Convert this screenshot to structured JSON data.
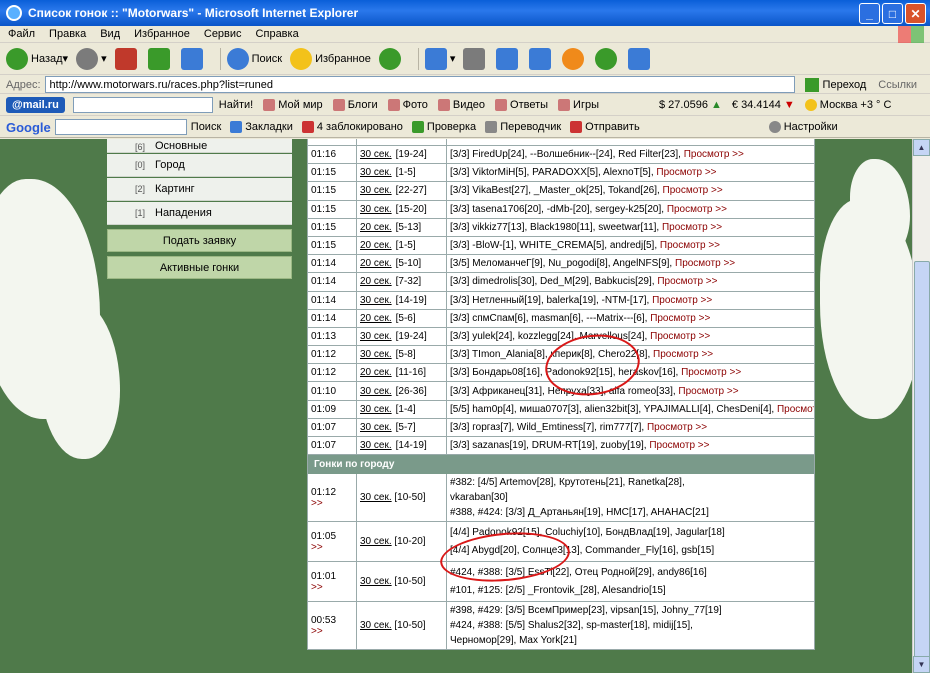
{
  "window": {
    "title": "Список гонок :: \"Motorwars\" - Microsoft Internet Explorer"
  },
  "menu": [
    "Файл",
    "Правка",
    "Вид",
    "Избранное",
    "Сервис",
    "Справка"
  ],
  "toolbar": {
    "back": "Назад",
    "search": "Поиск",
    "favorites": "Избранное"
  },
  "address": {
    "label": "Адрес:",
    "url": "http://www.motorwars.ru/races.php?list=runed",
    "go": "Переход",
    "links": "Ссылки"
  },
  "mailbar": {
    "logo": "@mail.ru",
    "find": "Найти!",
    "myworld": "Мой мир",
    "blogs": "Блоги",
    "photo": "Фото",
    "video": "Видео",
    "answers": "Ответы",
    "games": "Игры",
    "usd": "$ 27.0596",
    "eur": "€ 34.4144",
    "weather": "Москва +3 ° C"
  },
  "googlebar": {
    "logo": "Google",
    "search": "Поиск",
    "bookmarks": "Закладки",
    "blocked": "4 заблокировано",
    "check": "Проверка",
    "translate": "Переводчик",
    "send": "Отправить",
    "settings": "Настройки"
  },
  "sidebar": {
    "items": [
      {
        "count": "[6]",
        "label": "Основные"
      },
      {
        "count": "[0]",
        "label": "Город"
      },
      {
        "count": "[2]",
        "label": "Картинг"
      },
      {
        "count": "[1]",
        "label": "Нападения"
      }
    ],
    "btn_apply": "Подать заявку",
    "btn_active": "Активные гонки"
  },
  "races": [
    {
      "time": "01:16",
      "dur": "30 сек.",
      "lvl": "[19-24]",
      "players": "[3/3] FiredUp[24], --Волшебник--[24], Red Filter[23],",
      "view": "Просмотр >>"
    },
    {
      "time": "01:15",
      "dur": "30 сек.",
      "lvl": "[1-5]",
      "players": "[3/3] ViktorMiH[5], PARADOXX[5], AlexnoT[5],",
      "view": "Просмотр >>"
    },
    {
      "time": "01:15",
      "dur": "30 сек.",
      "lvl": "[22-27]",
      "players": "[3/3] VikaBest[27], _Master_ok[25], Tokand[26],",
      "view": "Просмотр >>"
    },
    {
      "time": "01:15",
      "dur": "30 сек.",
      "lvl": "[15-20]",
      "players": "[3/3] tasena1706[20], -dMb-[20], sergey-k25[20],",
      "view": "Просмотр >>"
    },
    {
      "time": "01:15",
      "dur": "20 сек.",
      "lvl": "[5-13]",
      "players": "[3/3] vikkiz77[13], Black1980[11], sweetwar[11],",
      "view": "Просмотр >>"
    },
    {
      "time": "01:15",
      "dur": "20 сек.",
      "lvl": "[1-5]",
      "players": "[3/3] -BloW-[1], WHITE_CREMA[5], andredj[5],",
      "view": "Просмотр >>"
    },
    {
      "time": "01:14",
      "dur": "20 сек.",
      "lvl": "[5-10]",
      "players": "[3/5] МеломанчеГ[9], Nu_pogodi[8], AngelNFS[9],",
      "view": "Просмотр >>"
    },
    {
      "time": "01:14",
      "dur": "20 сек.",
      "lvl": "[7-32]",
      "players": "[3/3] dimedrolis[30], Ded_M[29], Babkucis[29],",
      "view": "Просмотр >>"
    },
    {
      "time": "01:14",
      "dur": "30 сек.",
      "lvl": "[14-19]",
      "players": "[3/3] Нетленный[19], balerka[19], -NTM-[17],",
      "view": "Просмотр >>"
    },
    {
      "time": "01:14",
      "dur": "20 сек.",
      "lvl": "[5-6]",
      "players": "[3/3] спмСпам[6], masman[6], ---Matrix---[6],",
      "view": "Просмотр >>"
    },
    {
      "time": "01:13",
      "dur": "30 сек.",
      "lvl": "[19-24]",
      "players": "[3/3] yulek[24], kozzlegg[24], Marvellous[24],",
      "view": "Просмотр >>"
    },
    {
      "time": "01:12",
      "dur": "30 сек.",
      "lvl": "[5-8]",
      "players": "[3/3] TImon_Alania[8], кперик[8], Chero22[8],",
      "view": "Просмотр >>"
    },
    {
      "time": "01:12",
      "dur": "20 сек.",
      "lvl": "[11-16]",
      "players": "[3/3] Бондарь08[16], Padonok92[15], heraskov[16],",
      "view": "Просмотр >>"
    },
    {
      "time": "01:10",
      "dur": "30 сек.",
      "lvl": "[26-36]",
      "players": "[3/3] Африканец[31], Непруха[33], alfa romeo[33],",
      "view": "Просмотр >>"
    },
    {
      "time": "01:09",
      "dur": "30 сек.",
      "lvl": "[1-4]",
      "players": "[5/5] ham0p[4], миша0707[3], alien32bit[3], YPAJIMALLI[4], ChesDeni[4],",
      "view": "Просмотр >>"
    },
    {
      "time": "01:07",
      "dur": "30 сек.",
      "lvl": "[5-7]",
      "players": "[3/3] горгаз[7], Wild_Emtiness[7], rim777[7],",
      "view": "Просмотр >>"
    },
    {
      "time": "01:07",
      "dur": "30 сек.",
      "lvl": "[14-19]",
      "players": "[3/3] sazanas[19], DRUM-RT[19], zuoby[19],",
      "view": "Просмотр >>"
    }
  ],
  "city_section": "Гонки по городу",
  "city": [
    {
      "time": "01:12",
      "arrow": ">>",
      "dur": "30 сек.",
      "lvl": "[10-50]",
      "lines": [
        "#382: [4/5] Artemov[28], Крутотень[21], Ranetka[28],",
        "vkaraban[30]",
        "#388, #424: [3/3] Д_Артаньян[19], HMC[17], AHAHAC[21]"
      ]
    },
    {
      "time": "01:05",
      "arrow": ">>",
      "dur": "30 сек.",
      "lvl": "[10-20]",
      "lines": [
        "[4/4] Padonok92[15], Coluchiy[10], БондВлад[19], Jagular[18]",
        "[4/4] Abygd[20], Солнце3[13], Commander_Fly[16], gsb[15]"
      ]
    },
    {
      "time": "01:01",
      "arrow": ">>",
      "dur": "30 сек.",
      "lvl": "[10-50]",
      "lines": [
        "#424, #388: [3/5] EssTi[22], Отец Родной[29], andy86[16]",
        "#101, #125: [2/5] _Frontovik_[28], Alesandrio[15]"
      ]
    },
    {
      "time": "00:53",
      "arrow": ">>",
      "dur": "30 сек.",
      "lvl": "[10-50]",
      "lines": [
        "#398, #429: [3/5] ВсемПример[23], vipsan[15], Johny_77[19]",
        "#424, #388: [5/5] Shalus2[32], sp-master[18], midij[15],",
        "Черномор[29], Max York[21]"
      ]
    }
  ]
}
